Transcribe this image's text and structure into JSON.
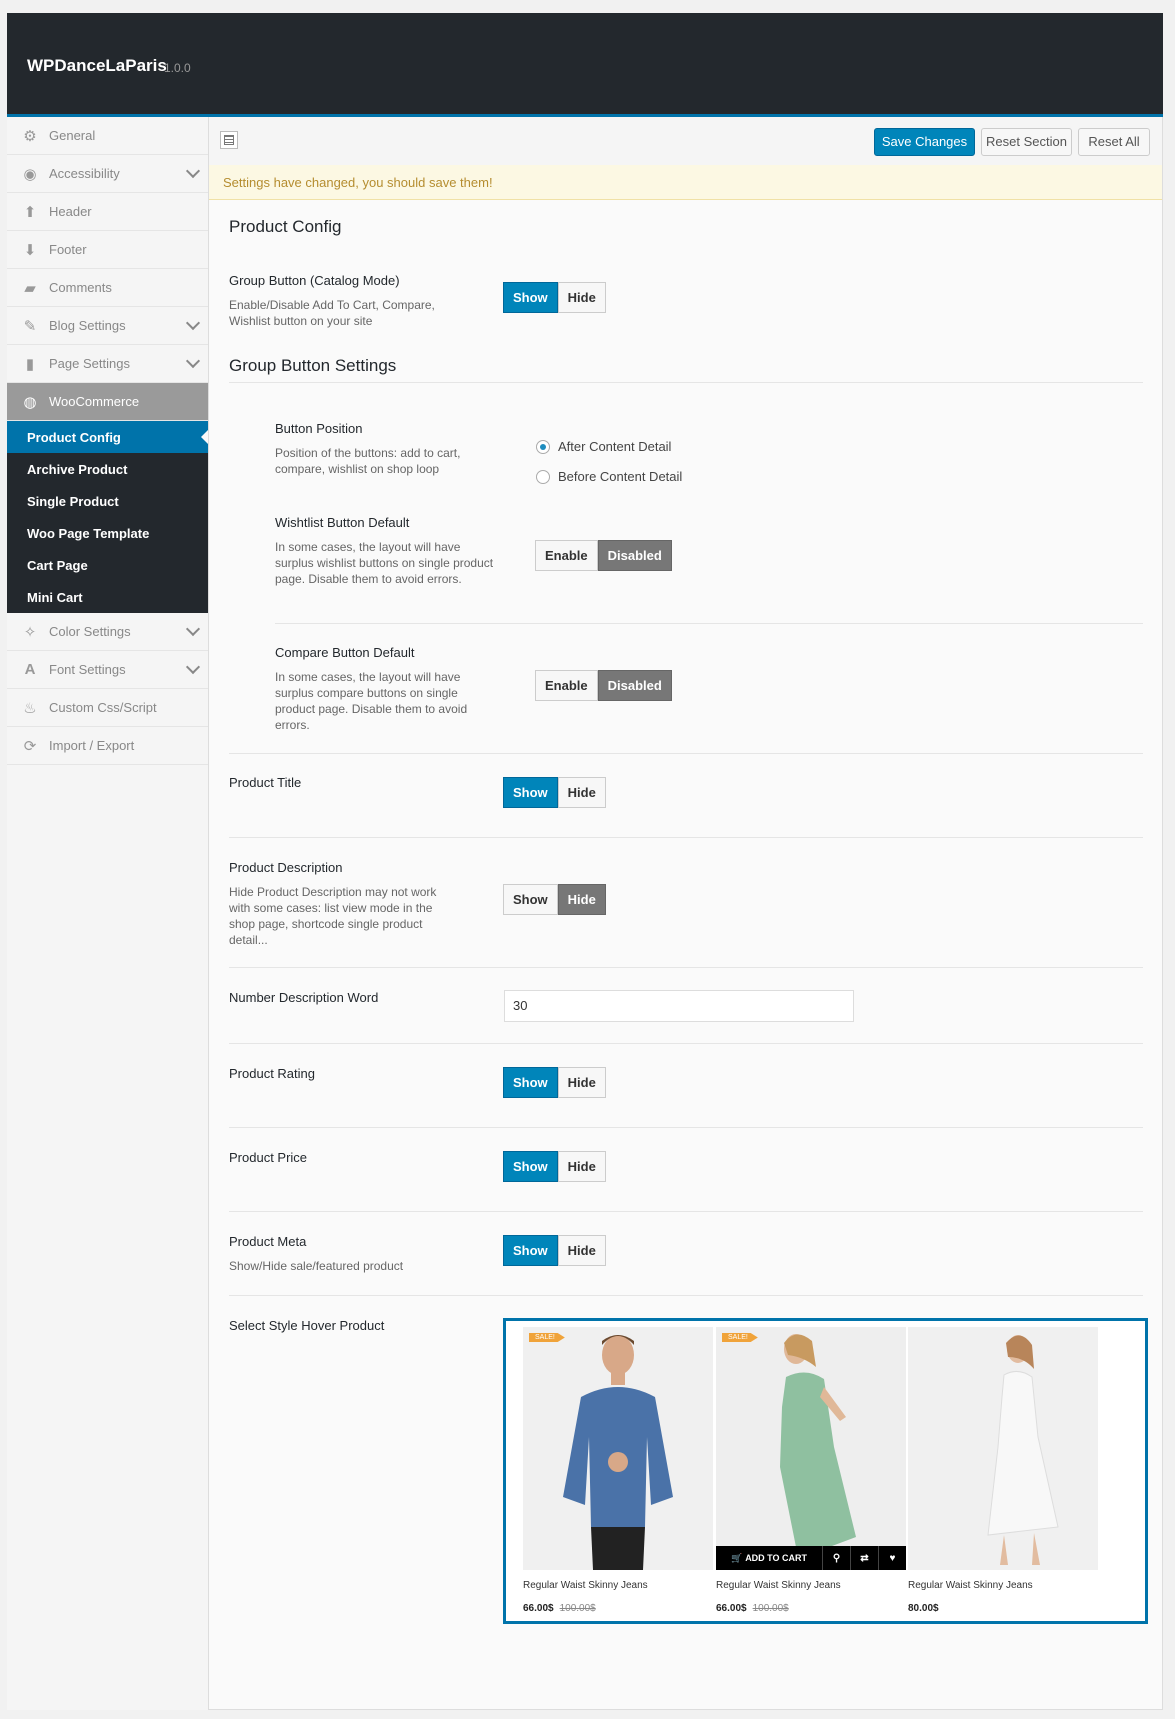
{
  "app": {
    "title": "WPDanceLaParis",
    "version": "1.0.0"
  },
  "sidebar": {
    "items": [
      {
        "label": "General",
        "icon": "gears-icon"
      },
      {
        "label": "Accessibility",
        "icon": "compass-icon"
      },
      {
        "label": "Header",
        "icon": "arrow-up-icon"
      },
      {
        "label": "Footer",
        "icon": "arrow-down-icon"
      },
      {
        "label": "Comments",
        "icon": "comments-icon"
      },
      {
        "label": "Blog Settings",
        "icon": "edit-icon"
      },
      {
        "label": "Page Settings",
        "icon": "page-icon"
      },
      {
        "label": "WooCommerce",
        "icon": "woocommerce-icon"
      }
    ],
    "sub_items": [
      "Product Config",
      "Archive Product",
      "Single Product",
      "Woo Page Template",
      "Cart Page",
      "Mini Cart"
    ],
    "items_after": [
      {
        "label": "Color Settings",
        "icon": "magic-wand-icon"
      },
      {
        "label": "Font Settings",
        "icon": "font-icon"
      },
      {
        "label": "Custom Css/Script",
        "icon": "fire-icon"
      },
      {
        "label": "Import / Export",
        "icon": "refresh-icon"
      }
    ]
  },
  "toolbar": {
    "save": "Save Changes",
    "reset_section": "Reset Section",
    "reset_all": "Reset All"
  },
  "notice": "Settings have changed, you should save them!",
  "section_title": "Product Config",
  "group_button": {
    "label": "Group Button (Catalog Mode)",
    "desc": "Enable/Disable Add To Cart, Compare, Wishlist button on your site",
    "show": "Show",
    "hide": "Hide"
  },
  "group_settings_title": "Group Button Settings",
  "button_position": {
    "label": "Button Position",
    "desc": "Position of the buttons: add to cart, compare, wishlist on shop loop",
    "options": [
      "After Content Detail",
      "Before Content Detail"
    ],
    "selected": "After Content Detail"
  },
  "wishlist": {
    "label": "Wishtlist Button Default",
    "desc": "In some cases, the layout will have surplus wishlist buttons on single product page. Disable them to avoid errors.",
    "enable": "Enable",
    "disabled": "Disabled"
  },
  "compare": {
    "label": "Compare Button Default",
    "desc": "In some cases, the layout will have surplus compare buttons on single product page. Disable them to avoid errors.",
    "enable": "Enable",
    "disabled": "Disabled"
  },
  "product_title": {
    "label": "Product Title",
    "show": "Show",
    "hide": "Hide"
  },
  "product_description": {
    "label": "Product Description",
    "desc": "Hide Product Description may not work with some cases: list view mode in the shop page, shortcode single product detail...",
    "show": "Show",
    "hide": "Hide"
  },
  "number_description": {
    "label": "Number Description Word",
    "value": "30"
  },
  "product_rating": {
    "label": "Product Rating",
    "show": "Show",
    "hide": "Hide"
  },
  "product_price": {
    "label": "Product Price",
    "show": "Show",
    "hide": "Hide"
  },
  "product_meta": {
    "label": "Product Meta",
    "desc": "Show/Hide sale/featured product",
    "show": "Show",
    "hide": "Hide"
  },
  "hover_style": {
    "label": "Select Style Hover Product",
    "cards": [
      {
        "name": "Regular Waist Skinny Jeans",
        "price": "66.00$",
        "old_price": "100.00$",
        "sale": "SALE!"
      },
      {
        "name": "Regular Waist Skinny Jeans",
        "price": "66.00$",
        "old_price": "100.00$",
        "sale": "SALE!",
        "add_to_cart": "ADD TO CART"
      },
      {
        "name": "Regular Waist Skinny Jeans",
        "price": "80.00$"
      }
    ]
  }
}
